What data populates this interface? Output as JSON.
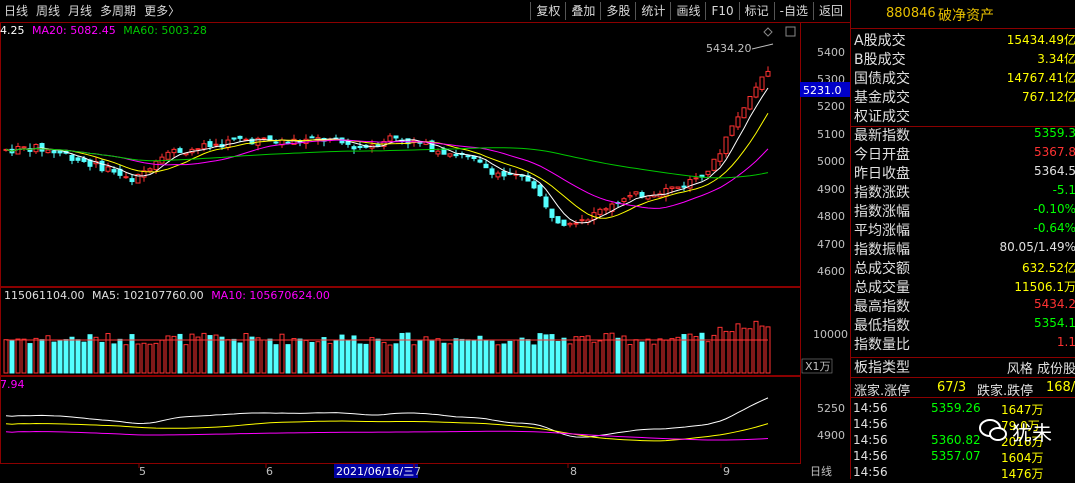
{
  "toolbar": {
    "left_items": [
      "日线",
      "周线",
      "月线",
      "多周期",
      "更多"
    ],
    "more_arrow": "〉",
    "right_items": [
      "复权",
      "叠加",
      "多股",
      "统计",
      "画线",
      "F10",
      "标记",
      "-自选",
      "返回"
    ]
  },
  "price_legend": {
    "ma5": "4.25",
    "ma20": "MA20: 5082.45",
    "ma60": "MA60: 5003.28"
  },
  "price_axis": [
    "5400",
    "5300",
    "5200",
    "5100",
    "5000",
    "4900",
    "4800",
    "4700",
    "4600"
  ],
  "current_price_tag": "5231.0",
  "high_annotation": "5434.20",
  "volume_legend": {
    "vol": "115061104.00",
    "ma5": "MA5: 102107760.00",
    "ma10": "MA10: 105670624.00"
  },
  "volume_axis": [
    "10000"
  ],
  "volume_unit": "X1万",
  "lower_legend": "7.94",
  "lower_axis": [
    "5250",
    "4900"
  ],
  "x_axis": {
    "labels": [
      "5",
      "6",
      "7",
      "8",
      "9"
    ],
    "cursor_date": "2021/06/16/三",
    "period": "日线"
  },
  "colors": {
    "up": "#ff3232",
    "down": "#54ffff",
    "ma5": "#ffffff",
    "ma10": "#ffff00",
    "ma20": "#ff00ff",
    "ma60": "#00c800",
    "border": "#8b0000"
  },
  "panel": {
    "code": "880846",
    "name": "破净资产",
    "stats": [
      {
        "label": "A股成交",
        "value": "15434.49亿",
        "color": "#ffff00"
      },
      {
        "label": "B股成交",
        "value": "3.34亿",
        "color": "#ffff00"
      },
      {
        "label": "国债成交",
        "value": "14767.41亿",
        "color": "#ffff00"
      },
      {
        "label": "基金成交",
        "value": "767.12亿",
        "color": "#ffff00"
      },
      {
        "label": "权证成交",
        "value": "",
        "color": "#ffff00"
      },
      {
        "label": "最新指数",
        "value": "5359.3",
        "color": "#00ff00"
      },
      {
        "label": "今日开盘",
        "value": "5367.8",
        "color": "#ff3232"
      },
      {
        "label": "昨日收盘",
        "value": "5364.5",
        "color": "#e0e0e0"
      },
      {
        "label": "指数涨跌",
        "value": "-5.1",
        "color": "#00ff00"
      },
      {
        "label": "指数涨幅",
        "value": "-0.10%",
        "color": "#00ff00"
      },
      {
        "label": "平均涨幅",
        "value": "-0.64%",
        "color": "#00ff00"
      },
      {
        "label": "指数振幅",
        "value": "80.05/1.49%",
        "color": "#e0e0e0"
      },
      {
        "label": "总成交额",
        "value": "632.52亿",
        "color": "#ffff00"
      },
      {
        "label": "总成交量",
        "value": "11506.1万",
        "color": "#ffff00"
      },
      {
        "label": "最高指数",
        "value": "5434.2",
        "color": "#ff3232"
      },
      {
        "label": "最低指数",
        "value": "5354.1",
        "color": "#00ff00"
      },
      {
        "label": "指数量比",
        "value": "1.1",
        "color": "#ff3232"
      }
    ],
    "board_type": {
      "label": "板指类型",
      "value": "风格 成份股"
    },
    "breadth": {
      "up_label": "涨家.涨停",
      "up_value": "67/3",
      "down_label": "跌家.跌停",
      "down_value": "168/"
    },
    "ticks": [
      {
        "time": "14:56",
        "price": "5359.26",
        "vol": "1647万"
      },
      {
        "time": "14:56",
        "price": "",
        "vol": "79.0万"
      },
      {
        "time": "14:56",
        "price": "5360.82",
        "vol": "2016万"
      },
      {
        "time": "14:56",
        "price": "5357.07",
        "vol": "1604万"
      },
      {
        "time": "14:56",
        "price": "",
        "vol": "1476万"
      }
    ]
  },
  "watermark": "犹未"
}
